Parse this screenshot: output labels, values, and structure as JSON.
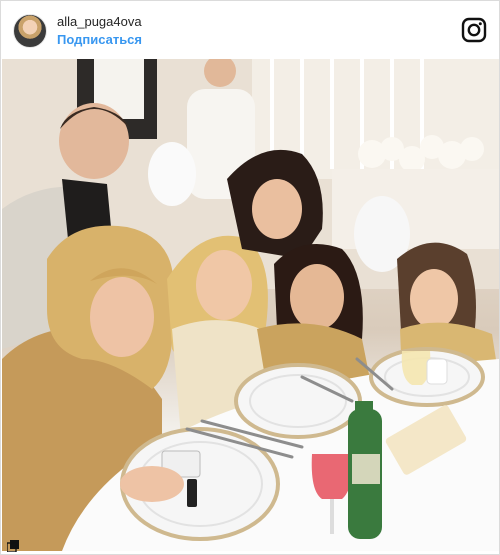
{
  "post": {
    "username": "alla_puga4ova",
    "follow_label": "Подписаться",
    "icons": {
      "avatar": "profile-avatar",
      "instagram": "instagram-glyph-icon",
      "carousel": "multi-photo-icon"
    },
    "colors": {
      "follow_blue": "#3897f0",
      "username_text": "#262626"
    }
  }
}
